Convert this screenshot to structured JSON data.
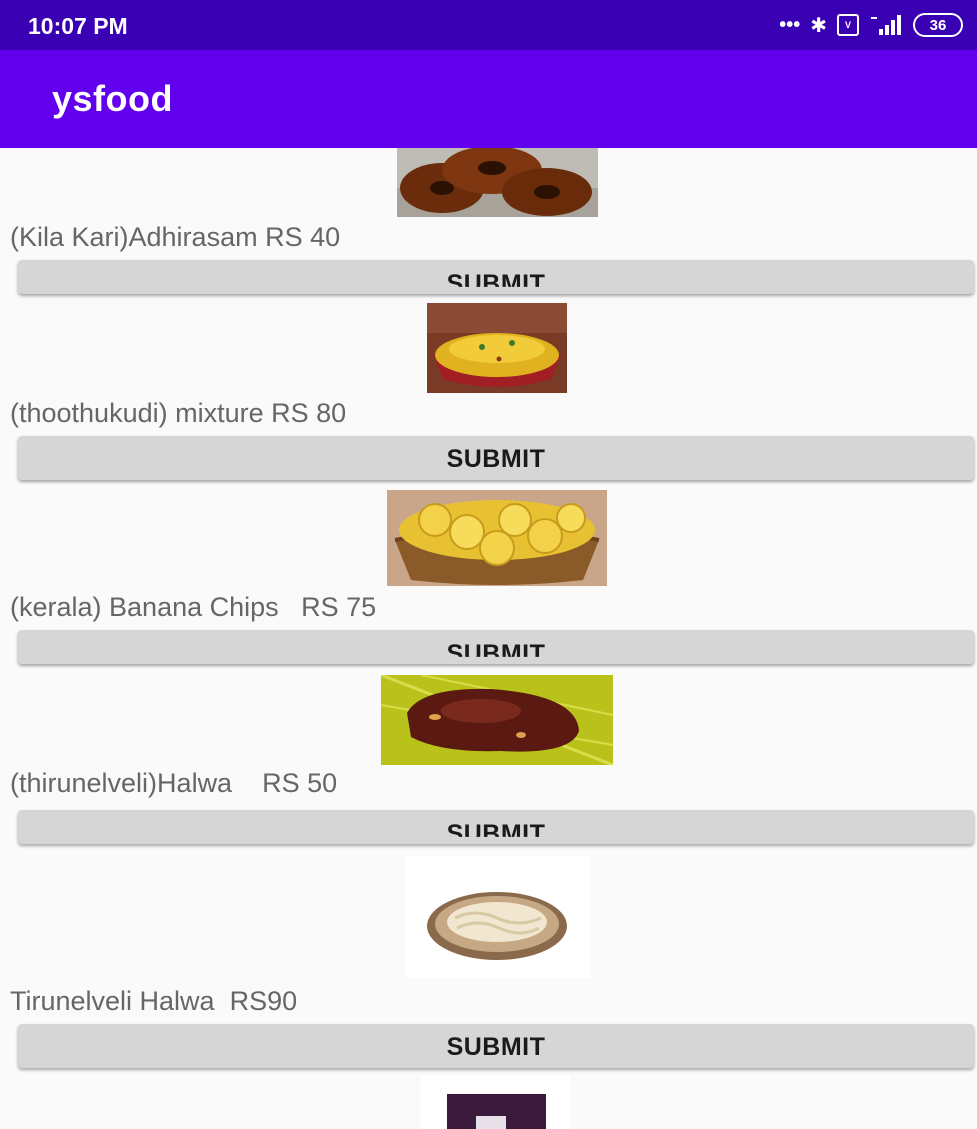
{
  "status_bar": {
    "time": "10:07 PM",
    "icons": [
      "more-dots-icon",
      "bluetooth-icon",
      "volte-icon",
      "signal-4g-icon",
      "battery-icon"
    ],
    "battery_level": "36"
  },
  "app_bar": {
    "title": "ysfood"
  },
  "items": [
    {
      "label": "(Kila Kari)Adhirasam RS 40",
      "button": "SUBMIT"
    },
    {
      "label": "(thoothukudi) mixture RS 80",
      "button": "SUBMIT"
    },
    {
      "label": "(kerala) Banana Chips   RS 75",
      "button": "SUBMIT"
    },
    {
      "label": "(thirunelveli)Halwa    RS 50",
      "button": "SUBMIT"
    },
    {
      "label": "Tirunelveli Halwa  RS90",
      "button": "SUBMIT"
    }
  ],
  "colors": {
    "status_bar": "#3a00b3",
    "app_bar": "#6200ee",
    "button": "#d6d6d6",
    "label": "#666666"
  }
}
